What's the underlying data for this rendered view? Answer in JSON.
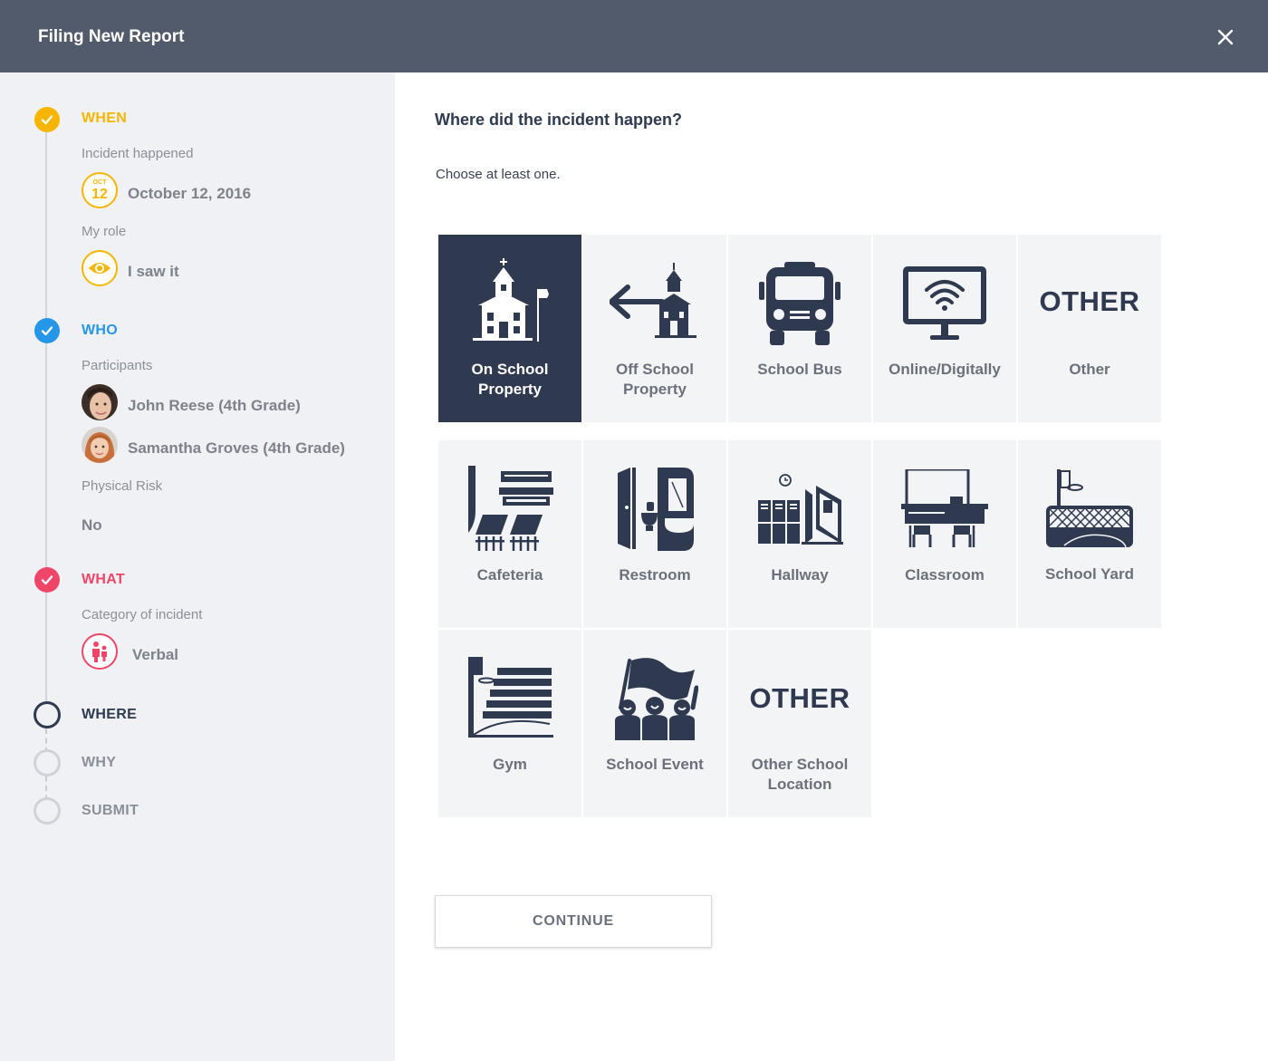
{
  "header": {
    "title": "Filing New Report",
    "close_icon": "close-icon"
  },
  "steps": [
    {
      "key": "when",
      "label": "WHEN",
      "status": "done",
      "color": "#f7b500",
      "fields": [
        {
          "label": "Incident happened",
          "value": "October 12, 2016",
          "icon": "calendar-icon",
          "calendar": {
            "month": "OCT",
            "day": "12"
          }
        },
        {
          "label": "My role",
          "value": "I saw it",
          "icon": "eye-icon"
        }
      ]
    },
    {
      "key": "who",
      "label": "WHO",
      "status": "done",
      "color": "#2596e8",
      "fields": [
        {
          "label": "Participants",
          "people": [
            "John Reese (4th Grade)",
            "Samantha Groves (4th Grade)"
          ]
        },
        {
          "label": "Physical Risk",
          "value": "No"
        }
      ]
    },
    {
      "key": "what",
      "label": "WHAT",
      "status": "done",
      "color": "#ef4668",
      "fields": [
        {
          "label": "Category of incident",
          "value": "Verbal",
          "icon": "verbal-incident-icon"
        }
      ]
    },
    {
      "key": "where",
      "label": "WHERE",
      "status": "current",
      "color": "#2d3a50"
    },
    {
      "key": "why",
      "label": "WHY",
      "status": "pending",
      "color": "#cfd2d8"
    },
    {
      "key": "submit",
      "label": "SUBMIT",
      "status": "pending",
      "color": "#cfd2d8"
    }
  ],
  "main": {
    "question": "Where did the incident happen?",
    "hint": "Choose at least one.",
    "other_text": "OTHER",
    "options": [
      {
        "label": "On School Property",
        "icon": "school-building-icon",
        "selected": true
      },
      {
        "label": "Off School Property",
        "icon": "off-school-arrow-icon",
        "selected": false
      },
      {
        "label": "School Bus",
        "icon": "school-bus-icon",
        "selected": false
      },
      {
        "label": "Online/Digitally",
        "icon": "wifi-monitor-icon",
        "selected": false
      },
      {
        "label": "Other",
        "icon": "other-text-icon",
        "selected": false
      },
      {
        "label": "Cafeteria",
        "icon": "cafeteria-icon",
        "selected": false
      },
      {
        "label": "Restroom",
        "icon": "restroom-icon",
        "selected": false
      },
      {
        "label": "Hallway",
        "icon": "hallway-lockers-icon",
        "selected": false
      },
      {
        "label": "Classroom",
        "icon": "classroom-icon",
        "selected": false
      },
      {
        "label": "School Yard",
        "icon": "school-yard-icon",
        "selected": false
      },
      {
        "label": "Gym",
        "icon": "gym-bleachers-icon",
        "selected": false
      },
      {
        "label": "School Event",
        "icon": "school-event-icon",
        "selected": false
      },
      {
        "label": "Other School Location",
        "icon": "other-text-icon",
        "selected": false
      }
    ],
    "continue_label": "CONTINUE"
  },
  "colors": {
    "header_bg": "#515b6c",
    "sidebar_bg": "#f0f1f4",
    "selected_tile": "#2f3a51",
    "tile_bg": "#f3f4f6"
  }
}
